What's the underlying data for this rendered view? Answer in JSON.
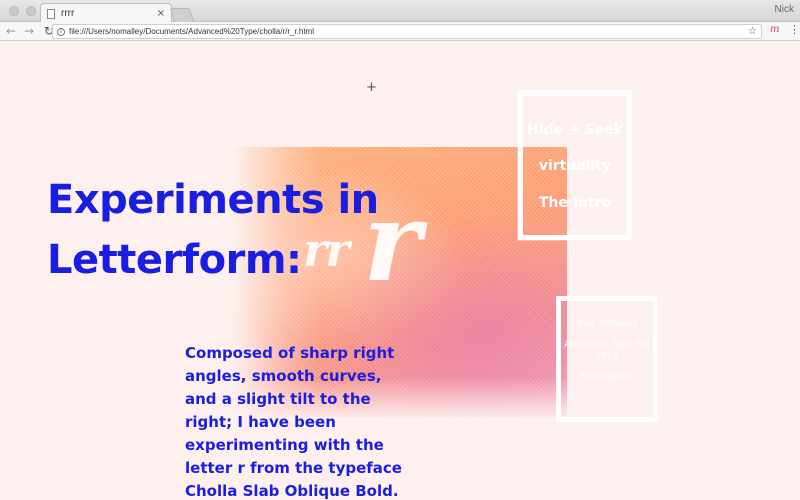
{
  "browser": {
    "tab_title": "rrrr",
    "profile_name": "Nick",
    "url": "file:///Users/nomalley/Documents/Advanced%20Type/cholla/r/r_r.html",
    "icons": {
      "back": "←",
      "forward": "→",
      "reload": "↻",
      "info": "i",
      "star": "☆",
      "extension": "m",
      "menu": "⋮",
      "close": "×",
      "crosshair": "+"
    }
  },
  "page": {
    "headline": "Experiments in Letterform:",
    "description": "Composed of sharp right angles, smooth curves, and a slight tilt to the right; I have been experimenting with the letter r from the typeface Cholla Slab Oblique Bold.",
    "art": {
      "small_text": "rr",
      "big_letter": "r"
    },
    "nav_links": [
      "Hide + Seek",
      "virtuality",
      "The Intro"
    ],
    "info": {
      "author": "Nick O'Malley",
      "course": "Advanced Type Fall 2016",
      "instructor": "Robin Lynch"
    },
    "colors": {
      "accent": "#1a1ee0",
      "background": "#fdf0ee"
    }
  }
}
